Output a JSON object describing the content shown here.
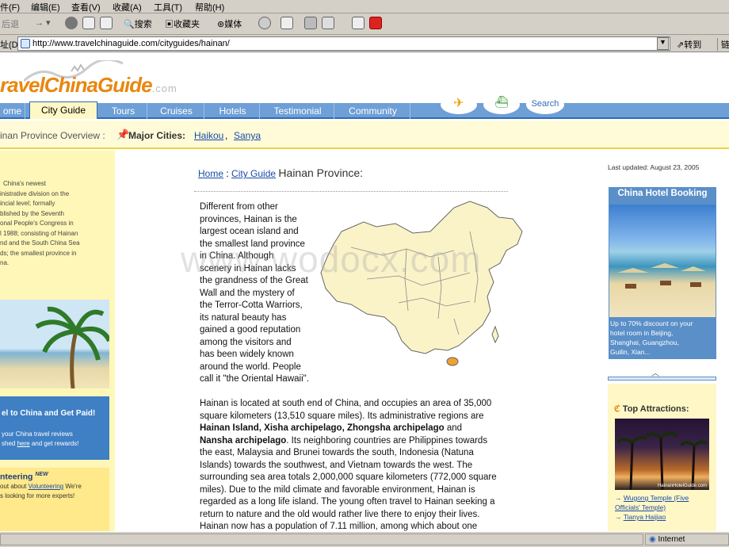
{
  "browser": {
    "menu": [
      "件(F)",
      "编辑(E)",
      "查看(V)",
      "收藏(A)",
      "工具(T)",
      "帮助(H)"
    ],
    "toolbar": {
      "back": "后退",
      "search": "搜索",
      "favorites": "收藏夹",
      "media": "媒体"
    },
    "address_label": "址(D)",
    "url": "http://www.travelchinaguide.com/cityguides/hainan/",
    "go": "转到",
    "links": "链",
    "status_zone": "Internet"
  },
  "site": {
    "logo_main": "ravelChinaGuide",
    "logo_suffix": ".com",
    "nav": [
      "ome",
      "City Guide",
      "Tours",
      "Cruises",
      "Hotels",
      "Testimonial",
      "Community"
    ],
    "search": "Search",
    "subbar_left": "inan Province Overview :",
    "major_cities_label": "Major Cities:",
    "cities": [
      "Haikou",
      "Sanya"
    ]
  },
  "breadcrumb": {
    "home": "Home",
    "sep": ":",
    "city_guide": "City Guide",
    "current": "Hainan Province:"
  },
  "last_updated": "Last updated: August 23, 2005",
  "intro_lines": [
    "Different from other",
    "provinces, Hainan is the",
    "largest ocean island and",
    "the smallest land province",
    "in China. Although",
    "scenery in Hainan lacks",
    "the grandness of the Great",
    "Wall and the mystery of",
    "the Terror-Cotta Warriors,",
    "its natural beauty has",
    "gained a good reputation",
    "among the visitors and",
    "has been widely known",
    "around the world. People",
    "call it \"the Oriental Hawaii\"."
  ],
  "body": {
    "l1": "Hainan is located at south end of China, and occupies an area of 35,000",
    "l2": "square kilometers (13,510 square miles). Its administrative regions are",
    "l3_bold": "Hainan Island, Xisha archipelago, Zhongsha archipelago",
    "l3_rest": " and",
    "l4_bold": "Nansha archipelago",
    "l4_rest": ". Its neighboring countries are Philippines towards",
    "lines": [
      "the east, Malaysia and Brunei towards the south, Indonesia (Natuna",
      "Islands) towards the southwest, and Vietnam towards the west. The",
      "surrounding sea area totals 2,000,000 square kilometers (772,000 square",
      "miles). Due to the mild climate and favorable environment, Hainan is",
      "regarded as a long life island. The young often travel to Hainan seeking a",
      "return to nature and the old would rather live there to enjoy their lives.",
      "Hainan now has a population of 7.11 million, among which about one"
    ]
  },
  "left": {
    "intro_lines": [
      "China's newest",
      "inistrative division on the",
      "incial level; formally",
      "blished by the Seventh",
      "onal People's Congress in",
      "l 1988; consisting of Hainan",
      "nd and the South China Sea",
      "ds; the smallest province in",
      "na."
    ],
    "travel_head": "el to China and Get Paid!",
    "travel_lines": [
      "your China travel reviews",
      "shed",
      "and get rewards!"
    ],
    "travel_here": "here",
    "vol_head": "nteering",
    "vol_new": "NEW",
    "vol_l1a": "out about",
    "vol_link": "Volunteering",
    "vol_l1b": "We're",
    "vol_l2": "s looking for more experts!"
  },
  "right": {
    "hotel_head": "China Hotel Booking",
    "hotel_text": [
      "Up to 70% discount on your",
      "hotel room in Beijing,",
      "Shanghai, Guangzhou,",
      "Guilin, Xian..."
    ],
    "attractions_head": "Top Attractions:",
    "photo_caption": "HainanHotelGuide.com",
    "attr_links": [
      "Wugong Temple (Five",
      "Officials' Temple)",
      "Tianya Haijiao"
    ]
  },
  "watermark": "www.wodocx.com"
}
